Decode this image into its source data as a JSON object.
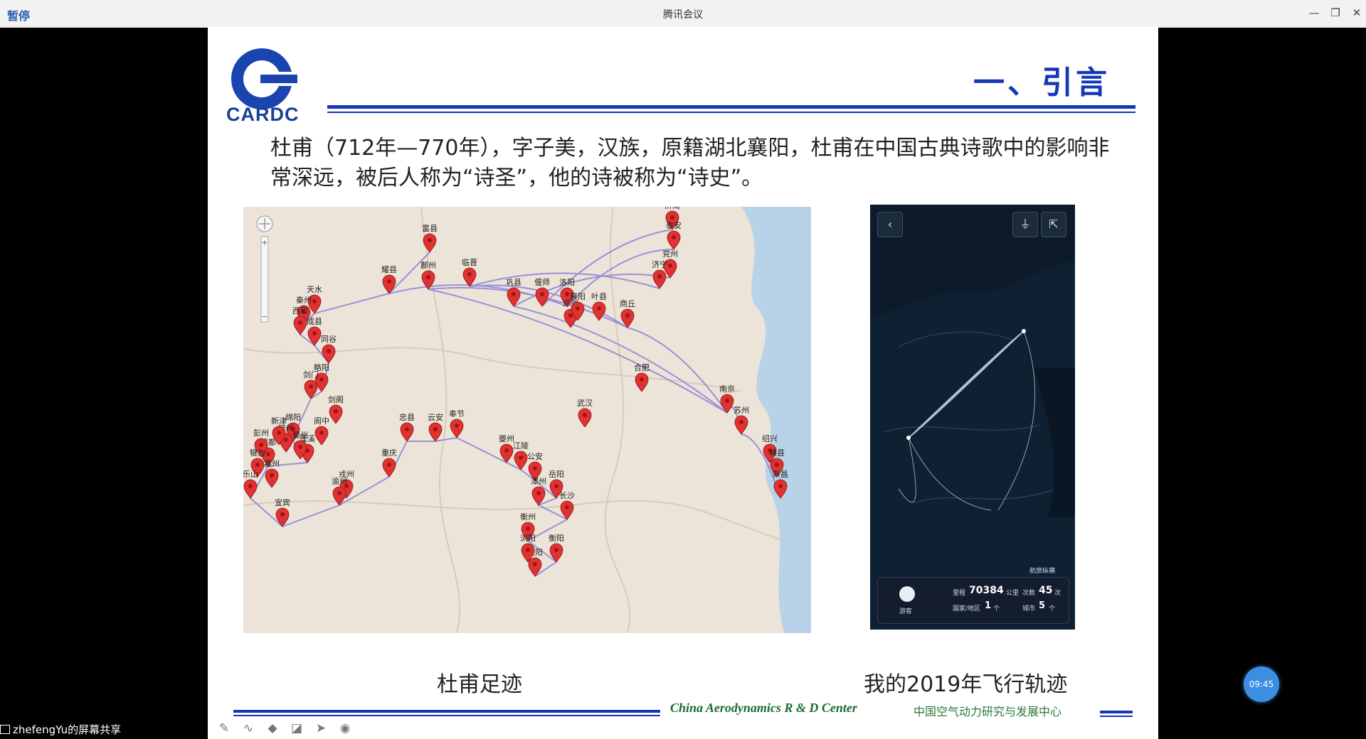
{
  "window": {
    "pause_label": "暂停",
    "title": "腾讯会议",
    "minimize": "—",
    "restore": "❐",
    "close": "✕"
  },
  "slide": {
    "logo_text": "CARDC",
    "title": "一、引言",
    "intro": "杜甫（712年—770年），字子美，汉族，原籍湖北襄阳，杜甫在中国古典诗歌中的影响非常深远，被后人称为“诗圣”，他的诗被称为“诗史”。",
    "caption_left": "杜甫足迹",
    "caption_right": "我的2019年飞行轨迹",
    "footer_en": "China Aerodynamics R & D Center",
    "footer_cn": "中国空气动力研究与发展中心"
  },
  "map": {
    "labels": [
      "济南",
      "泰安",
      "富县",
      "耀县",
      "鄜州",
      "临晋",
      "巩县",
      "偃师",
      "洛阳",
      "商丘",
      "兖州",
      "济宁",
      "天水",
      "秦州",
      "西和",
      "成县",
      "同谷",
      "略阳",
      "剑门",
      "剑阁",
      "绵阳",
      "梓州",
      "阆中",
      "蓬溪",
      "成都",
      "彭州",
      "蜀州",
      "新津",
      "犍为",
      "嘉州",
      "乐山",
      "宜宾",
      "戎州",
      "渝州",
      "重庆",
      "忠县",
      "云安",
      "奉节",
      "夔州",
      "江陵",
      "公安",
      "岳阳",
      "潭州",
      "长沙",
      "衡州",
      "衡阳",
      "耒阳",
      "浏阳",
      "南京",
      "苏州",
      "绍兴",
      "嵊县",
      "新昌",
      "邓州",
      "襄阳",
      "叶县",
      "合肥",
      "武汉"
    ]
  },
  "phone": {
    "back": "‹",
    "filter": "⏚",
    "share": "⇱",
    "brand": "航旅纵横",
    "user": "游客",
    "distance_label": "里程",
    "distance": "70384",
    "distance_unit": "公里",
    "count_label": "次数",
    "count": "45",
    "count_unit": "次",
    "region_label": "国家/地区",
    "region": "1",
    "region_unit": "个",
    "city_label": "城市",
    "city": "5",
    "city_unit": "个"
  },
  "meeting": {
    "clock": "09:45",
    "share_label": "zhefengYu的屏幕共享"
  },
  "toolbar": {
    "icons": [
      "pen-icon",
      "curve-icon",
      "highlighter-icon",
      "eraser-icon",
      "pointer-icon",
      "record-icon"
    ]
  },
  "colors": {
    "accent": "#1537b6",
    "footer_green": "#1a6a33",
    "map_bg": "#ece4d8",
    "phone_bg": "#102033",
    "pin": "#e13232",
    "route": "#8c82d8"
  }
}
